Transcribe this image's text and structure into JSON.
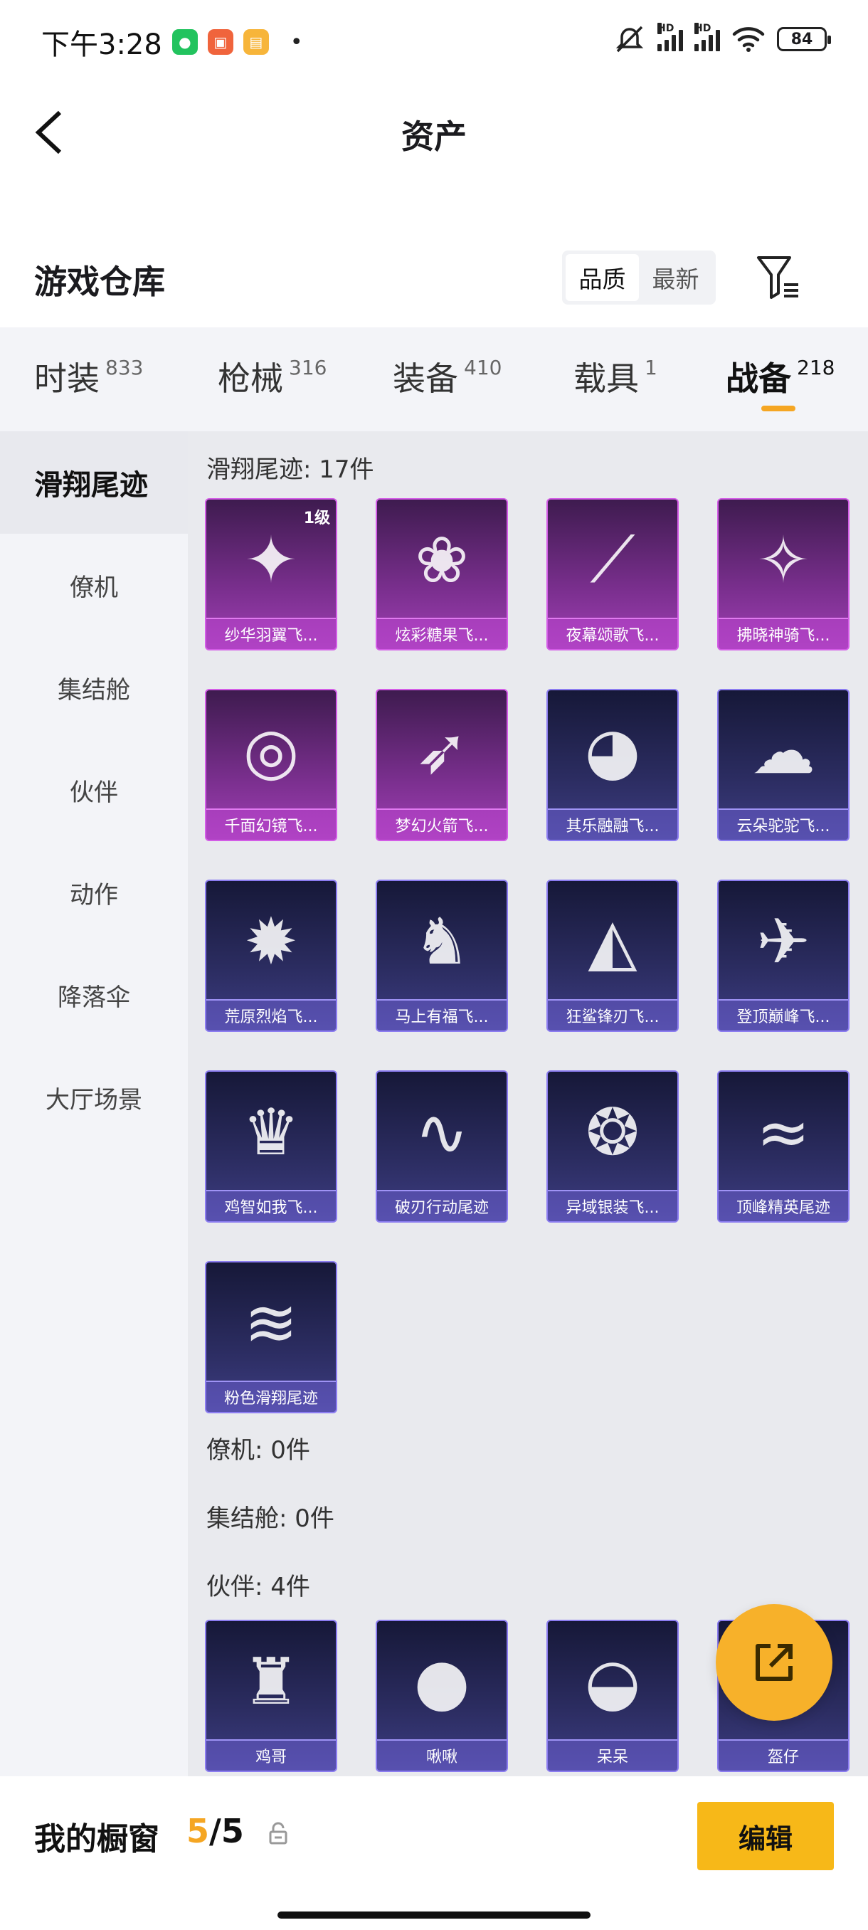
{
  "status_bar": {
    "time": "下午3:28",
    "battery": "84",
    "network": "HD"
  },
  "header": {
    "title": "资产"
  },
  "warehouse": {
    "title": "游戏仓库",
    "sort_options": [
      "品质",
      "最新"
    ],
    "selected_sort": "品质"
  },
  "tabs": [
    {
      "label": "时装",
      "count": "833"
    },
    {
      "label": "枪械",
      "count": "316"
    },
    {
      "label": "装备",
      "count": "410"
    },
    {
      "label": "载具",
      "count": "1"
    },
    {
      "label": "战备",
      "count": "218"
    }
  ],
  "active_tab": "战备",
  "sidebar": {
    "items": [
      "滑翔尾迹",
      "僚机",
      "集结舱",
      "伙伴",
      "动作",
      "降落伞",
      "大厅场景"
    ],
    "active": "滑翔尾迹"
  },
  "sections": [
    {
      "title": "滑翔尾迹: 17件",
      "items": [
        {
          "name": "纱华羽翼飞...",
          "rarity": "purple",
          "level": "1级",
          "icon": "winged-emblem-icon"
        },
        {
          "name": "炫彩糖果飞...",
          "rarity": "purple",
          "icon": "candy-icon"
        },
        {
          "name": "夜幕颂歌飞...",
          "rarity": "purple",
          "icon": "spear-icon"
        },
        {
          "name": "拂晓神骑飞...",
          "rarity": "purple",
          "icon": "mount-icon"
        },
        {
          "name": "千面幻镜飞...",
          "rarity": "purple",
          "icon": "ufo-icon"
        },
        {
          "name": "梦幻火箭飞...",
          "rarity": "purple",
          "icon": "rocket-icon"
        },
        {
          "name": "其乐融融飞...",
          "rarity": "blue",
          "icon": "penguin-icon"
        },
        {
          "name": "云朵驼驼飞...",
          "rarity": "blue",
          "icon": "alpaca-icon"
        },
        {
          "name": "荒原烈焰飞...",
          "rarity": "blue",
          "icon": "flame-guitar-icon"
        },
        {
          "name": "马上有福飞...",
          "rarity": "blue",
          "icon": "horse-icon"
        },
        {
          "name": "狂鲨锋刃飞...",
          "rarity": "blue",
          "icon": "shark-icon"
        },
        {
          "name": "登顶巅峰飞...",
          "rarity": "blue",
          "icon": "jet-icon"
        },
        {
          "name": "鸡智如我飞...",
          "rarity": "blue",
          "icon": "chicken-icon"
        },
        {
          "name": "破刃行动尾迹",
          "rarity": "blue",
          "icon": "rainbow-trail-icon"
        },
        {
          "name": "异域银装飞...",
          "rarity": "blue",
          "icon": "dragon-icon"
        },
        {
          "name": "顶峰精英尾迹",
          "rarity": "blue",
          "icon": "smoke-trail-icon"
        },
        {
          "name": "粉色滑翔尾迹",
          "rarity": "blue",
          "icon": "pink-trail-icon"
        }
      ]
    },
    {
      "title": "僚机: 0件",
      "items": []
    },
    {
      "title": "集结舱: 0件",
      "items": []
    },
    {
      "title": "伙伴: 4件",
      "items": [
        {
          "name": "鸡哥",
          "rarity": "blue",
          "icon": "rooster-icon"
        },
        {
          "name": "啾啾",
          "rarity": "blue",
          "icon": "pink-bird-icon"
        },
        {
          "name": "呆呆",
          "rarity": "blue",
          "icon": "chick-icon"
        },
        {
          "name": "盔仔",
          "rarity": "blue",
          "icon": "helmet-pet-icon"
        }
      ]
    }
  ],
  "bottom_bar": {
    "label": "我的橱窗",
    "current": "5",
    "separator": "/",
    "max": "5",
    "edit_label": "编辑"
  },
  "colors": {
    "accent": "#f5a623",
    "edit_button": "#f7b818",
    "purple_card": "#a03fb4",
    "blue_card": "#3d3d82"
  }
}
